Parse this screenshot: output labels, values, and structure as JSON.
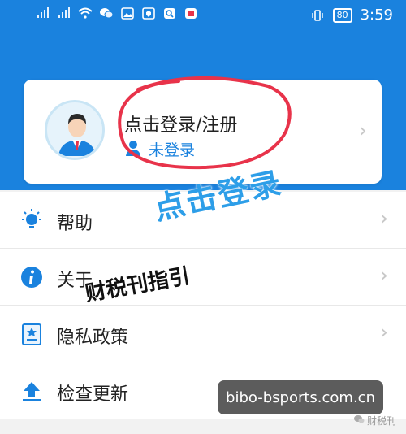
{
  "status_bar": {
    "time": "3:59",
    "battery": "80",
    "icons": [
      "signal-icon",
      "signal-icon",
      "wifi-icon",
      "wechat-icon",
      "image-icon",
      "shield-icon",
      "search-icon",
      "app-icon",
      "vibrate-icon"
    ]
  },
  "profile_card": {
    "title": "点击登录/注册",
    "status": "未登录",
    "avatar_icon": "user-avatar-icon"
  },
  "menu": {
    "items": [
      {
        "label": "帮助",
        "icon": "bulb-icon"
      },
      {
        "label": "关于",
        "icon": "info-icon"
      },
      {
        "label": "隐私政策",
        "icon": "document-icon"
      },
      {
        "label": "检查更新",
        "icon": "upload-icon"
      }
    ]
  },
  "annotations": {
    "click_login": "点击登录",
    "guide": "财税刊指引"
  },
  "watermark": {
    "site": "bibo-bsports.com.cn",
    "account": "财税刊"
  },
  "colors": {
    "primary": "#1a82de",
    "annotation_red": "#e8334a"
  }
}
